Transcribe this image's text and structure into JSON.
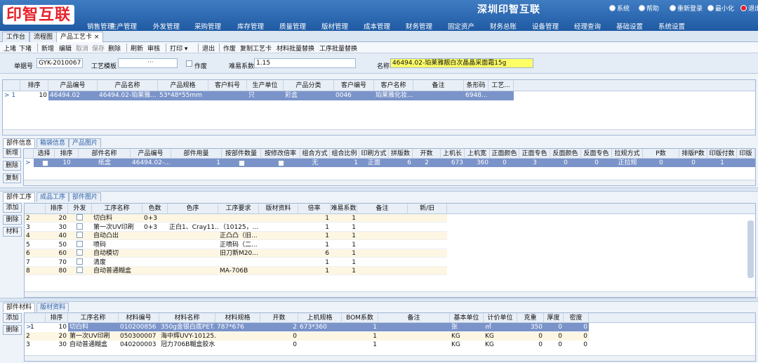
{
  "app": {
    "logo": "印智互联",
    "company": "深圳印智互联",
    "system_buttons": [
      "系统",
      "帮助",
      "重新登录",
      "最小化",
      "退出"
    ],
    "menu": [
      "销售管理",
      "生产管理",
      "外发管理",
      "采购管理",
      "库存管理",
      "质量管理",
      "版材管理",
      "成本管理",
      "财务管理",
      "固定资产",
      "财务总账",
      "设备管理",
      "经理查询",
      "基础设置",
      "系统设置"
    ]
  },
  "tabs": [
    {
      "label": "工作台"
    },
    {
      "label": "流程图"
    },
    {
      "label": "产品工艺卡"
    }
  ],
  "tab_close": "×",
  "toolbar": [
    "上堵",
    "下堵",
    "新增",
    "编辑",
    "取消",
    "保存",
    "删除",
    "刷新",
    "审核",
    "打印",
    "退出",
    "作废",
    "复制工艺卡",
    "材料批量替换",
    "工序批量替换"
  ],
  "print_arrow": "▾",
  "form": {
    "doc_no_label": "单据号",
    "doc_no": "GYK-2010067",
    "template_label": "工艺模板",
    "template_value": "",
    "template_btn": "···",
    "void_label": "作废",
    "difficulty_label": "难易系数",
    "difficulty": "1.15",
    "name_label": "名称",
    "name": "46494.02-珀莱雅靓白次晶晶采面霜15g"
  },
  "product_table": {
    "headers": [
      "排序",
      "产品编号",
      "产品名称",
      "产品规格",
      "客户料号",
      "生产单位",
      "产品分类",
      "客户编号",
      "客户名称",
      "备注",
      "条形码",
      "工艺..."
    ],
    "row": {
      "indicator": ">",
      "num": "1",
      "order": "10",
      "code": "46494.02",
      "name": "46494.02-珀莱雅...",
      "spec": "53*48*55mm",
      "cust_part": "",
      "unit": "只",
      "category": "彩盒",
      "cust_code": "0046",
      "cust_name": "珀莱雅化妆...",
      "note": "",
      "barcode": "6948...",
      "craft": ""
    }
  },
  "part_section": {
    "tabs": [
      "部件信息",
      "箱袋信息",
      "产品图片"
    ],
    "side_buttons": [
      "新增",
      "删除",
      "复制"
    ],
    "headers": [
      "选择",
      "排序",
      "部件名称",
      "产品编号",
      "部件用量",
      "按部件数量",
      "按修改倍率",
      "组合方式",
      "组合比例",
      "印刷方式",
      "拼版数",
      "开数",
      "上机长",
      "上机宽",
      "正面颜色",
      "正面专色",
      "反面颜色",
      "反面专色",
      "拉规方式",
      "P数",
      "排版P数",
      "印版付数",
      "印版"
    ],
    "row": {
      "indicator": ">",
      "order": "10",
      "name": "纸盒",
      "code": "46494.02-...",
      "usage": "1",
      "combo": "无",
      "ratio": "1",
      "print": "正面",
      "imposition": "6",
      "kai": "2",
      "len": "673",
      "wid": "360",
      "front_color": "0",
      "front_spot": "3",
      "back_color": "0",
      "back_spot": "0",
      "pull": "正拉规",
      "p": "0",
      "p2": "0",
      "plates": "1"
    }
  },
  "process_section": {
    "tabs": [
      "部件工序",
      "成品工序",
      "部件图片"
    ],
    "side_buttons": [
      "添加",
      "删除",
      "材料"
    ],
    "headers": [
      "排序",
      "外发",
      "工序名称",
      "色数",
      "色序",
      "工序要求",
      "版材资料",
      "倍率",
      "难易系数",
      "备注",
      "新/旧"
    ],
    "rows": [
      {
        "num": "2",
        "order": "20",
        "name": "切白料",
        "colors": "0+3",
        "seq": "",
        "req": "",
        "plate": "",
        "rate": "1",
        "diff": "1"
      },
      {
        "num": "3",
        "order": "30",
        "name": "第一次UV印刷",
        "colors": "0+3",
        "seq": "正白1、Cray11...",
        "req": "（10125，...",
        "plate": "",
        "rate": "1",
        "diff": "1"
      },
      {
        "num": "4",
        "order": "40",
        "name": "自动凸出",
        "colors": "",
        "seq": "",
        "req": "正凸凸（旧...",
        "plate": "",
        "rate": "1",
        "diff": "1"
      },
      {
        "num": "5",
        "order": "50",
        "name": "喷码",
        "colors": "",
        "seq": "",
        "req": "正喷码（二...",
        "plate": "",
        "rate": "1",
        "diff": "1"
      },
      {
        "num": "6",
        "order": "60",
        "name": "自动模切",
        "colors": "",
        "seq": "",
        "req": "旧刀新M20...",
        "plate": "",
        "rate": "6",
        "diff": "1"
      },
      {
        "num": "7",
        "order": "70",
        "name": "清废",
        "colors": "",
        "seq": "",
        "req": "",
        "plate": "",
        "rate": "1",
        "diff": "1"
      },
      {
        "num": "8",
        "order": "80",
        "name": "自动普通糊盒",
        "colors": "",
        "seq": "",
        "req": "MA-706B",
        "plate": "",
        "rate": "1",
        "diff": "1"
      }
    ]
  },
  "material_section": {
    "tabs": [
      "部件材料",
      "版材资料"
    ],
    "side_buttons": [
      "添加",
      "删除"
    ],
    "headers": [
      "排序",
      "工序名称",
      "材料编号",
      "材料名称",
      "材料规格",
      "开数",
      "上机规格",
      "BOM系数",
      "备注",
      "基本单位",
      "计价单位",
      "克重",
      "厚度",
      "密度"
    ],
    "rows": [
      {
        "num": "1",
        "order": "10",
        "proc": "切白料",
        "code": "010200856",
        "name": "350g金银白底PET...",
        "spec": "787*676",
        "kai": "2",
        "mspec": "673*360",
        "bom": "1",
        "note": "",
        "unit": "张",
        "price_unit": "㎡",
        "gram": "350",
        "thick": "0",
        "dens": "0",
        "selected": true
      },
      {
        "num": "2",
        "order": "20",
        "proc": "第一次UV印刷",
        "code": "050300007",
        "name": "海中辉UVY-10125...",
        "spec": "",
        "kai": "0",
        "mspec": "",
        "bom": "1",
        "note": "",
        "unit": "KG",
        "price_unit": "KG",
        "gram": "0",
        "thick": "0",
        "dens": "0",
        "selected": false
      },
      {
        "num": "3",
        "order": "30",
        "proc": "自动普通糊盒",
        "code": "040200003",
        "name": "冠力706B糊盒胶水",
        "spec": "",
        "kai": "0",
        "mspec": "",
        "bom": "1",
        "note": "",
        "unit": "KG",
        "price_unit": "KG",
        "gram": "0",
        "thick": "0",
        "dens": "0",
        "selected": false
      }
    ]
  },
  "colors": {
    "topbar": "#2a67b0",
    "selected_row": "#7a93c9",
    "name_highlight": "#ffff66",
    "logo_red": "#e8222a"
  }
}
